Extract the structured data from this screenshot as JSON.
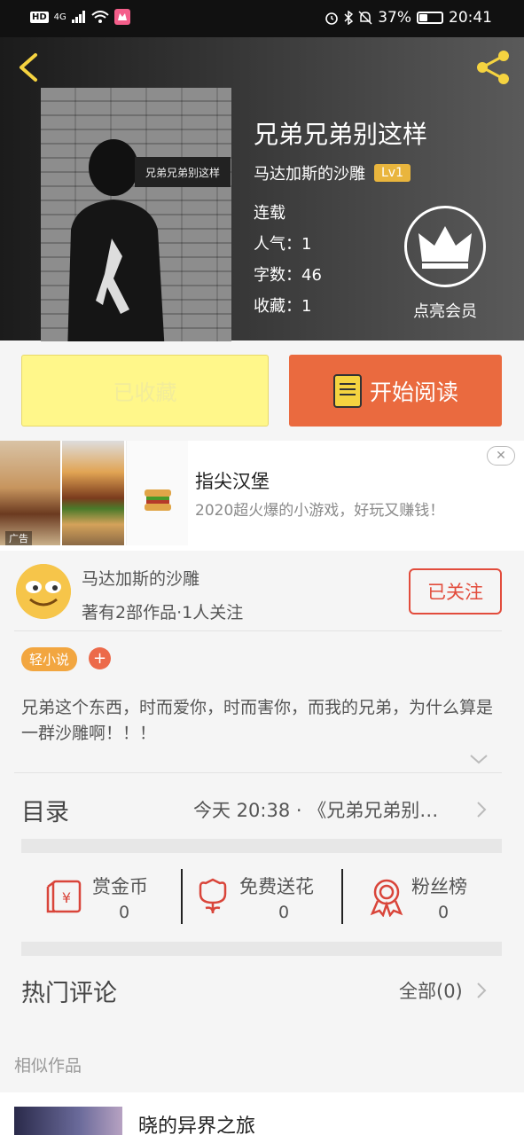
{
  "status_bar": {
    "left_chip": "HD",
    "network": "4G",
    "battery_percent": "37%",
    "battery_level": 0.37,
    "time": "20:41"
  },
  "book": {
    "title": "兄弟兄弟别这样",
    "cover_sign_text": "兄弟兄弟别这样",
    "author": "马达加斯的沙雕",
    "level_badge": "Lv1",
    "status": "连载",
    "popularity": "人气：1",
    "word_count": "字数：46",
    "favorites": "收藏：1",
    "vip_label": "点亮会员"
  },
  "actions": {
    "favorite_label": "已收藏",
    "read_label": "开始阅读"
  },
  "ad": {
    "title": "指尖汉堡",
    "description": "2020超火爆的小游戏，好玩又赚钱！",
    "tag": "广告",
    "close_symbol": "✕"
  },
  "author_card": {
    "name": "马达加斯的沙雕",
    "summary": "著有2部作品·1人关注",
    "follow_label": "已关注"
  },
  "tags": {
    "light_novel": "轻小说",
    "add_symbol": "+"
  },
  "intro_text": "兄弟这个东西，时而爱你，时而害你，而我的兄弟，为什么算是一群沙雕啊！！！",
  "toc": {
    "label": "目录",
    "latest": "今天 20:38 · 《兄弟兄弟别…"
  },
  "stats": [
    {
      "label": "赏金币",
      "value": "0",
      "icon": "red-envelope-icon"
    },
    {
      "label": "免费送花",
      "value": "0",
      "icon": "flower-icon"
    },
    {
      "label": "粉丝榜",
      "value": "0",
      "icon": "ribbon-medal-icon"
    }
  ],
  "comments": {
    "label": "热门评论",
    "all_label": "全部(0)"
  },
  "similar": {
    "section_title": "相似作品",
    "items": [
      {
        "title": "晓的异界之旅"
      }
    ]
  },
  "colors": {
    "accent_orange": "#ea6a3f",
    "favorite_yellow": "#fff78a",
    "icon_yellow": "#f5d340",
    "follow_red": "#e24c3c",
    "tag_orange": "#f2a640"
  }
}
